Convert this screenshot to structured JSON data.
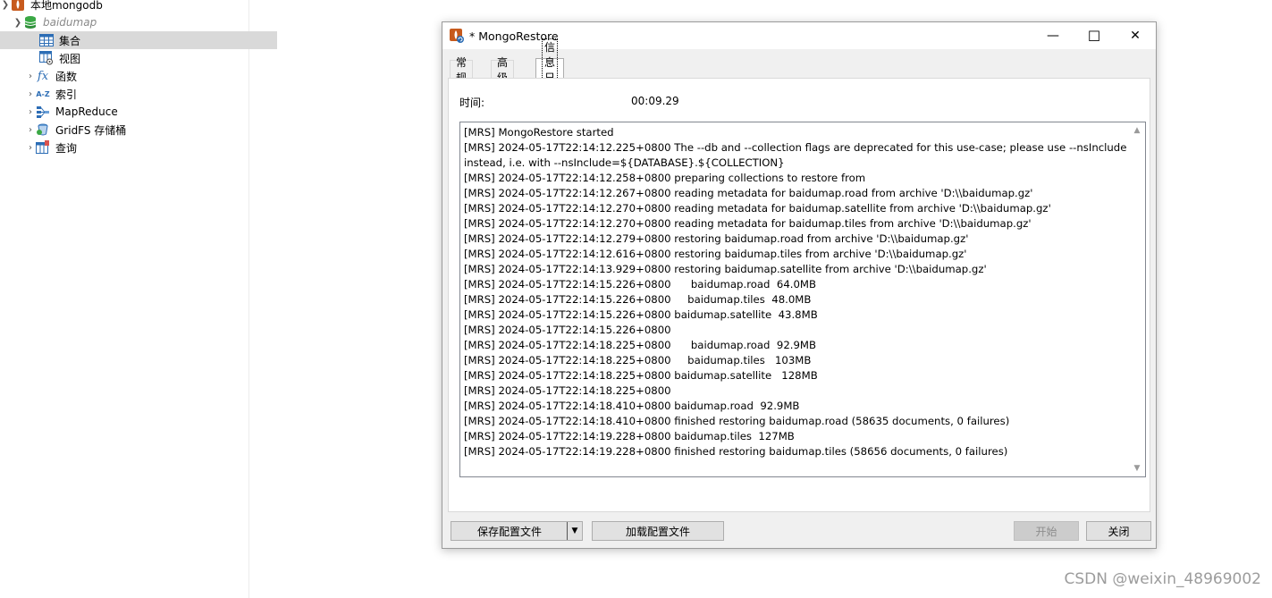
{
  "tree": {
    "connection": "本地mongodb",
    "database": "baidumap",
    "items": [
      {
        "label": "集合",
        "icon": "table-icon",
        "expandable": false,
        "selected": true
      },
      {
        "label": "视图",
        "icon": "view-icon",
        "expandable": false,
        "selected": false
      },
      {
        "label": "函数",
        "icon": "function-icon",
        "glyph": "fx",
        "expandable": true,
        "selected": false
      },
      {
        "label": "索引",
        "icon": "index-icon",
        "glyph": "A-Z",
        "expandable": true,
        "selected": false
      },
      {
        "label": "MapReduce",
        "icon": "mapreduce-icon",
        "expandable": true,
        "selected": false
      },
      {
        "label": "GridFS 存储桶",
        "icon": "gridfs-icon",
        "expandable": true,
        "selected": false
      },
      {
        "label": "查询",
        "icon": "query-icon",
        "expandable": true,
        "selected": false
      }
    ]
  },
  "dialog": {
    "title": "* MongoRestore",
    "window_buttons": {
      "minimize": "—",
      "maximize": "☐",
      "close": "✕"
    },
    "tabs": [
      {
        "label": "常规",
        "active": false
      },
      {
        "label": "高级",
        "active": false
      },
      {
        "label": "信息日志",
        "active": true
      }
    ],
    "time_label": "时间:",
    "time_value": "00:09.29",
    "log": [
      "[MRS] MongoRestore started",
      "[MRS] 2024-05-17T22:14:12.225+0800 The --db and --collection flags are deprecated for this use-case; please use --nsInclude instead, i.e. with --nsInclude=${DATABASE}.${COLLECTION}",
      "[MRS] 2024-05-17T22:14:12.258+0800 preparing collections to restore from",
      "[MRS] 2024-05-17T22:14:12.267+0800 reading metadata for baidumap.road from archive 'D:\\\\baidumap.gz'",
      "[MRS] 2024-05-17T22:14:12.270+0800 reading metadata for baidumap.satellite from archive 'D:\\\\baidumap.gz'",
      "[MRS] 2024-05-17T22:14:12.270+0800 reading metadata for baidumap.tiles from archive 'D:\\\\baidumap.gz'",
      "[MRS] 2024-05-17T22:14:12.279+0800 restoring baidumap.road from archive 'D:\\\\baidumap.gz'",
      "[MRS] 2024-05-17T22:14:12.616+0800 restoring baidumap.tiles from archive 'D:\\\\baidumap.gz'",
      "[MRS] 2024-05-17T22:14:13.929+0800 restoring baidumap.satellite from archive 'D:\\\\baidumap.gz'",
      "[MRS] 2024-05-17T22:14:15.226+0800      baidumap.road  64.0MB",
      "[MRS] 2024-05-17T22:14:15.226+0800     baidumap.tiles  48.0MB",
      "[MRS] 2024-05-17T22:14:15.226+0800 baidumap.satellite  43.8MB",
      "[MRS] 2024-05-17T22:14:15.226+0800",
      "[MRS] 2024-05-17T22:14:18.225+0800      baidumap.road  92.9MB",
      "[MRS] 2024-05-17T22:14:18.225+0800     baidumap.tiles   103MB",
      "[MRS] 2024-05-17T22:14:18.225+0800 baidumap.satellite   128MB",
      "[MRS] 2024-05-17T22:14:18.225+0800",
      "[MRS] 2024-05-17T22:14:18.410+0800 baidumap.road  92.9MB",
      "[MRS] 2024-05-17T22:14:18.410+0800 finished restoring baidumap.road (58635 documents, 0 failures)",
      "[MRS] 2024-05-17T22:14:19.228+0800 baidumap.tiles  127MB",
      "[MRS] 2024-05-17T22:14:19.228+0800 finished restoring baidumap.tiles (58656 documents, 0 failures)"
    ],
    "buttons": {
      "save_config": "保存配置文件",
      "load_config": "加载配置文件",
      "start": "开始",
      "close": "关闭"
    }
  },
  "watermark": "CSDN @weixin_48969002",
  "colors": {
    "selected_row": "#d9d9d9",
    "dialog_bg": "#f0f0f0",
    "db_green": "#3aa845",
    "disabled_button": "#cccccc"
  }
}
